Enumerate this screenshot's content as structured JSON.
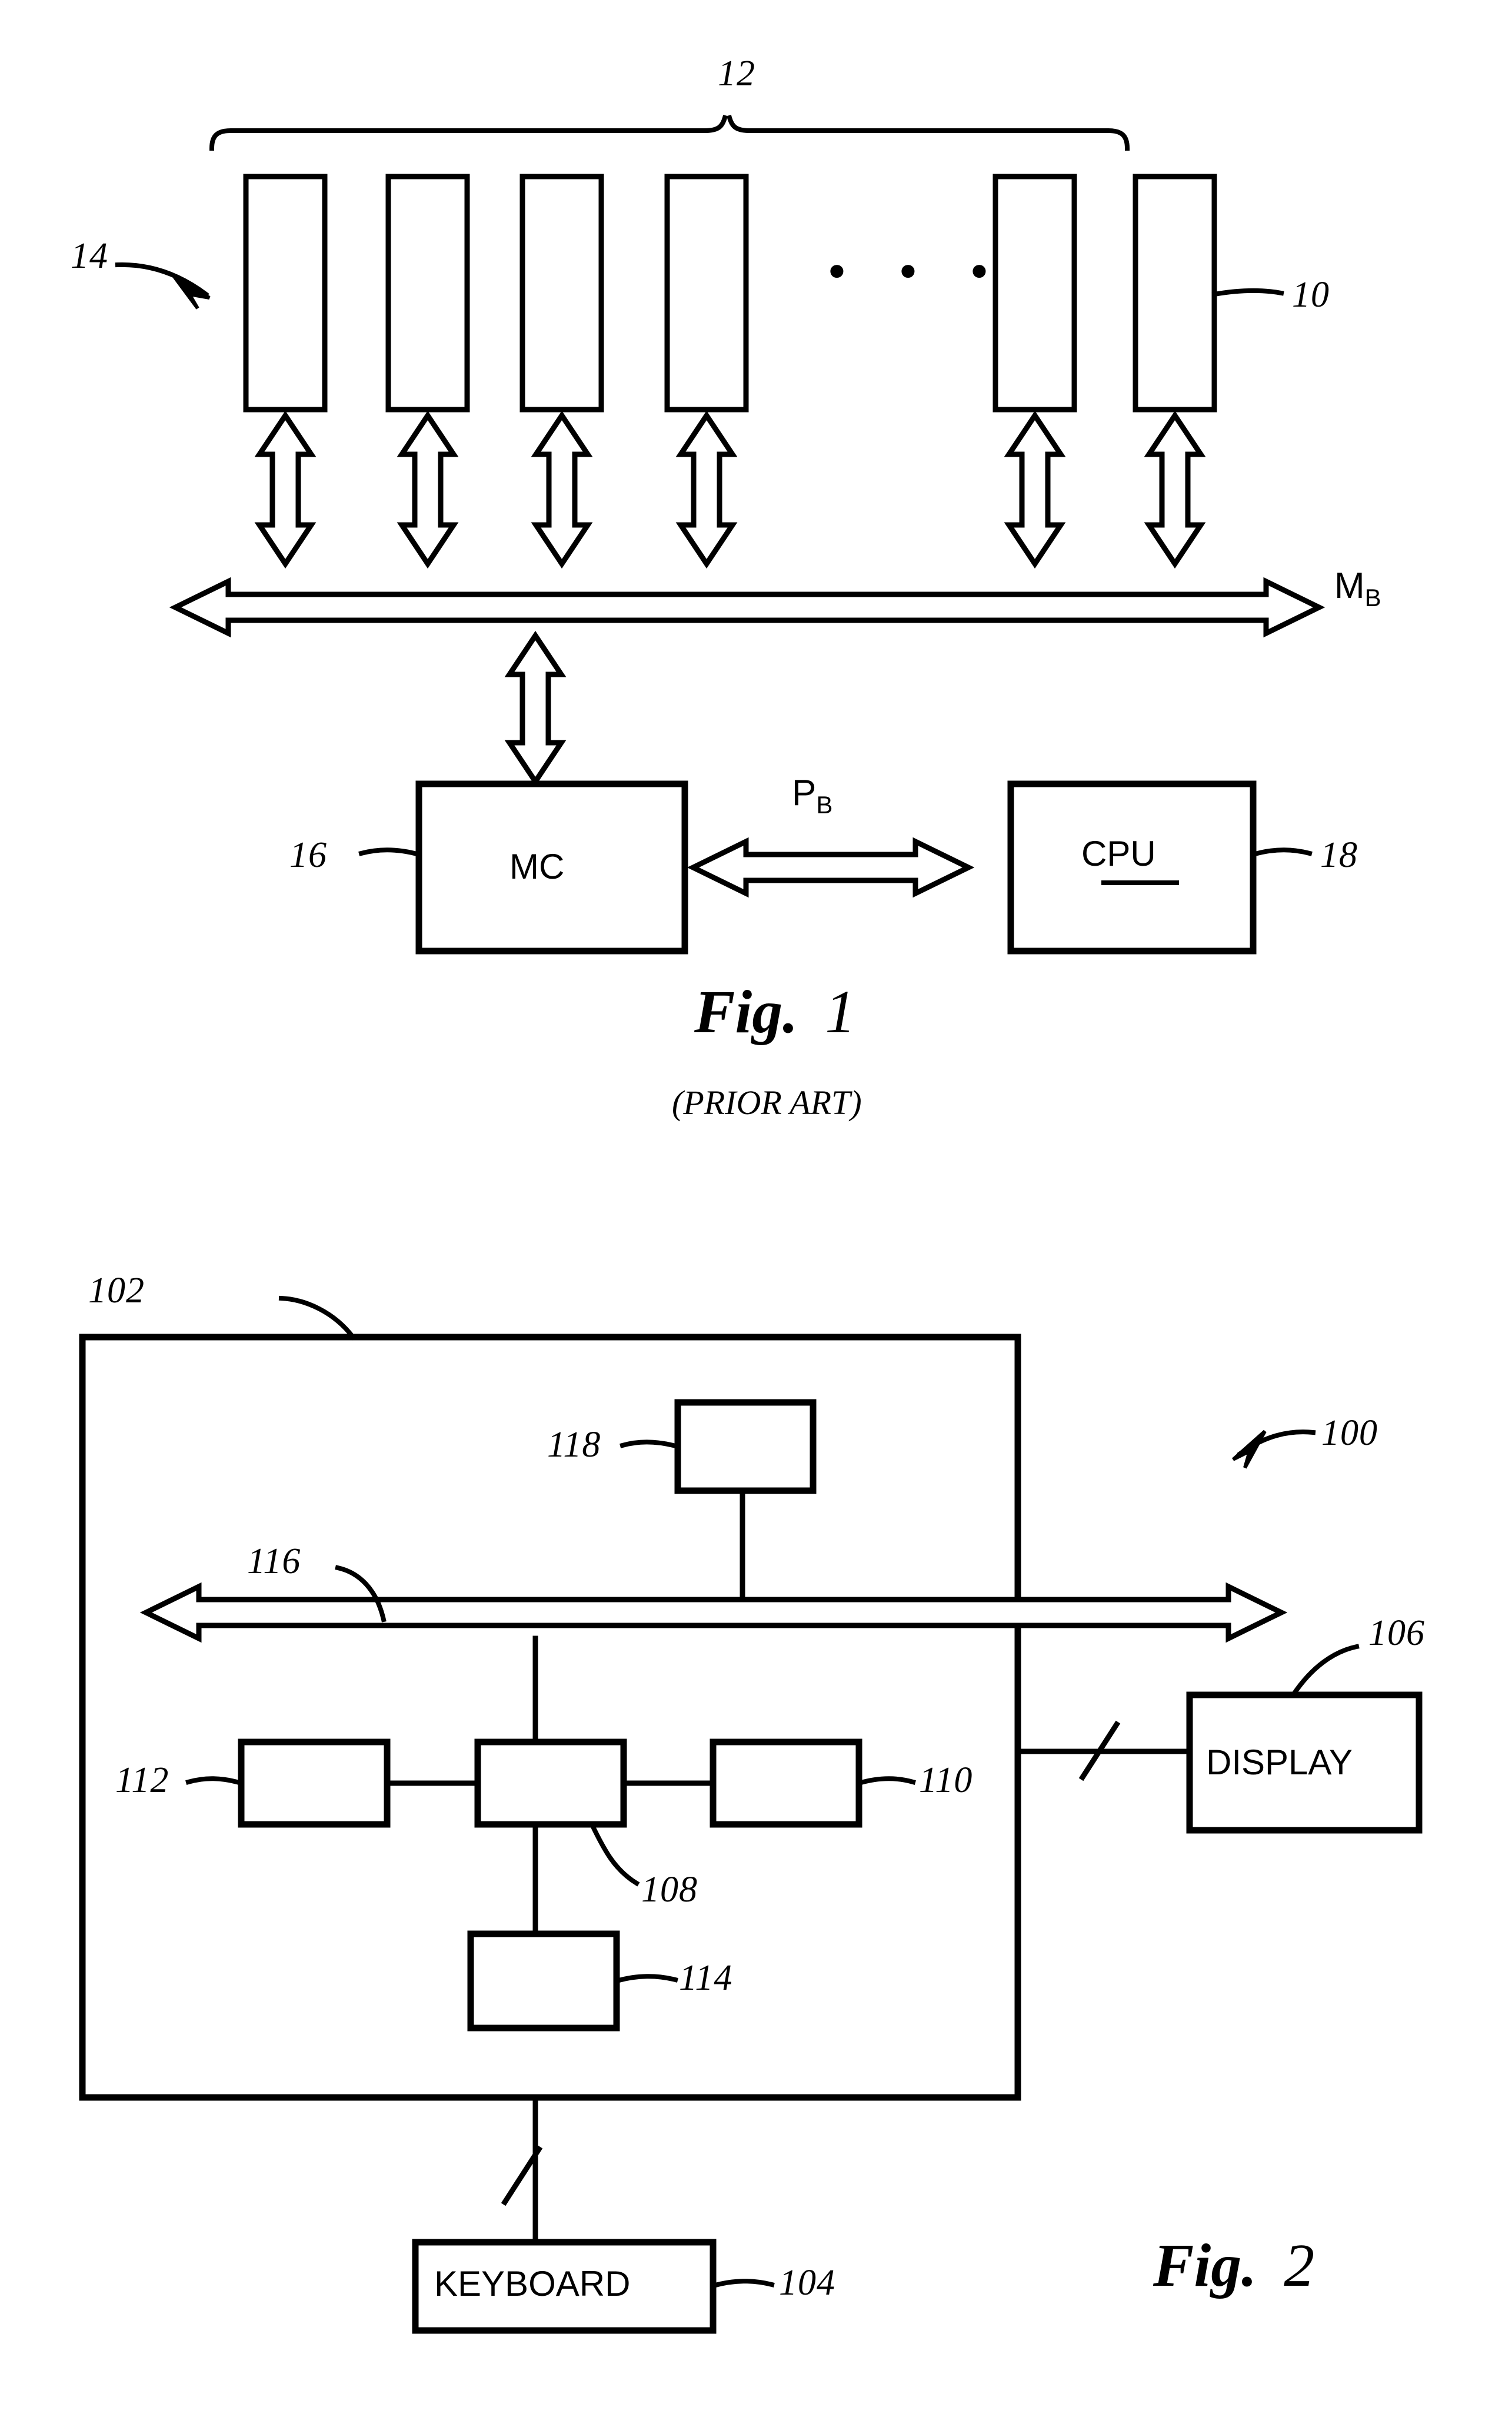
{
  "document": {
    "type": "patent-drawing-sheet",
    "background_color": "#ffffff",
    "ink_color": "#000000"
  },
  "figure1": {
    "caption": "Fig.",
    "caption_number": "1",
    "subcaption": "(PRIOR ART)",
    "ellipsis": "• • •",
    "refs": {
      "brace_label": "12",
      "array_arrow_label": "14",
      "module_label": "10",
      "mc_label": "16",
      "cpu_label": "18"
    },
    "boxes": [
      {
        "name": "memory-module-1",
        "text": ""
      },
      {
        "name": "memory-module-2",
        "text": ""
      },
      {
        "name": "memory-module-3",
        "text": ""
      },
      {
        "name": "memory-module-4",
        "text": ""
      },
      {
        "name": "memory-module-5",
        "text": ""
      },
      {
        "name": "memory-module-6",
        "text": ""
      }
    ],
    "memory_bus_label": "M",
    "memory_bus_subscript": "B",
    "processor_bus_label": "P",
    "processor_bus_subscript": "B",
    "mc_box_text": "MC",
    "cpu_box_text": "CPU"
  },
  "figure2": {
    "caption": "Fig.",
    "caption_number": "2",
    "refs": {
      "chassis_label": "102",
      "system_label": "100",
      "display_label": "106",
      "bus_label": "116",
      "memory_label": "118",
      "cpu_label": "108",
      "left_block_label": "112",
      "right_block_label": "110",
      "lower_block_label": "114",
      "keyboard_label": "104"
    },
    "display_box_text": "DISPLAY",
    "keyboard_box_text": "KEYBOARD",
    "boxes": [
      {
        "name": "block-118",
        "text": ""
      },
      {
        "name": "block-112",
        "text": ""
      },
      {
        "name": "block-108",
        "text": ""
      },
      {
        "name": "block-110",
        "text": ""
      },
      {
        "name": "block-114",
        "text": ""
      }
    ]
  }
}
